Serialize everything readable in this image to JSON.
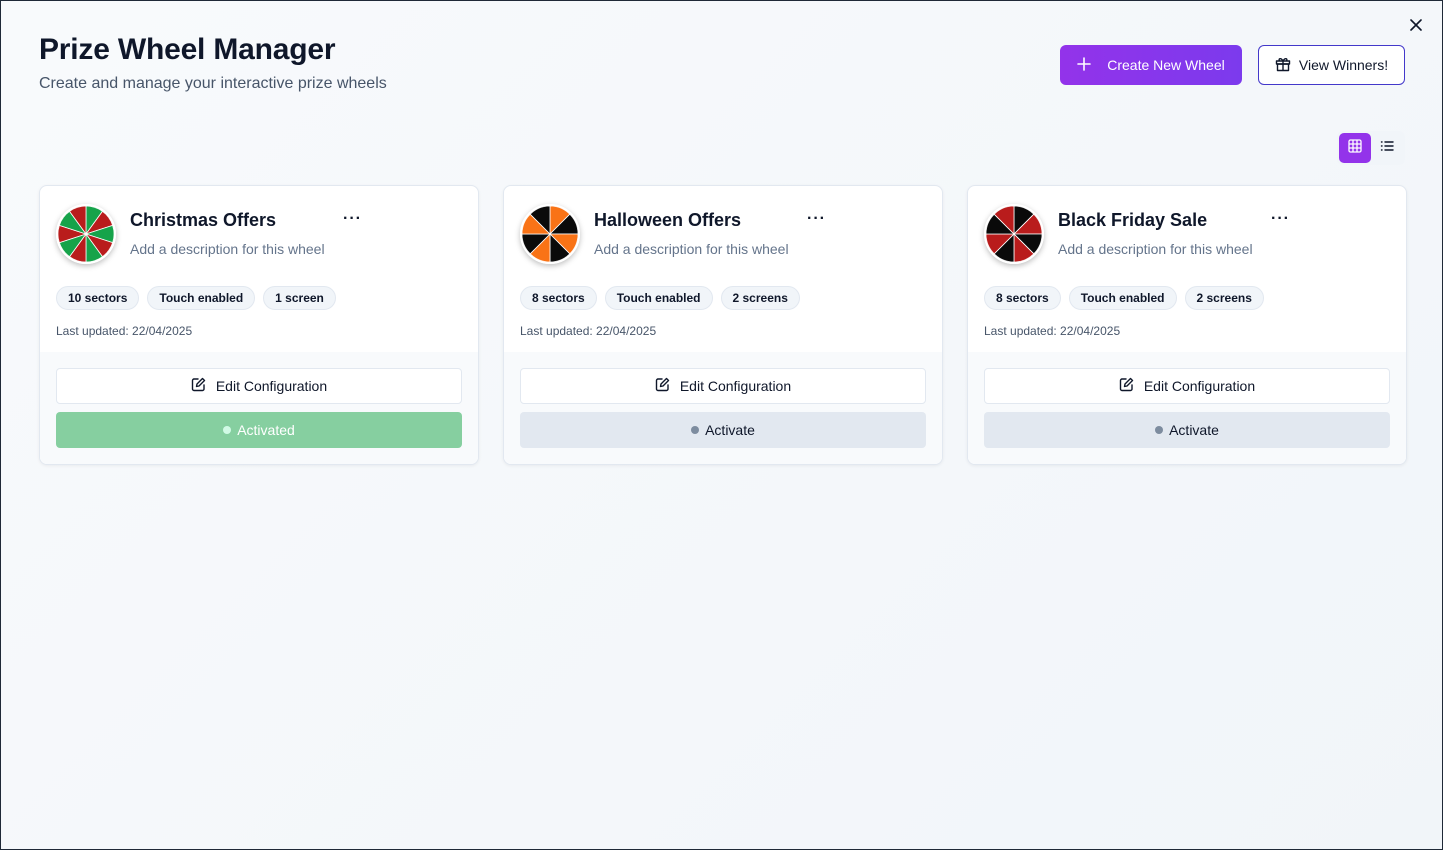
{
  "header": {
    "title": "Prize Wheel Manager",
    "subtitle": "Create and manage your interactive prize wheels",
    "create_label": "Create New Wheel",
    "winners_label": "View Winners!"
  },
  "view_toggle": {
    "active": "grid"
  },
  "wheels": [
    {
      "name": "Christmas Offers",
      "description": "Add a description for this wheel",
      "sectors": "10 sectors",
      "touch": "Touch enabled",
      "screens": "1 screen",
      "updated": "Last updated: 22/04/2025",
      "edit_label": "Edit Configuration",
      "status_label": "Activated",
      "activated": true,
      "colors": [
        "#16a34a",
        "#b91c1c"
      ],
      "sector_count": 10
    },
    {
      "name": "Halloween Offers",
      "description": "Add a description for this wheel",
      "sectors": "8 sectors",
      "touch": "Touch enabled",
      "screens": "2 screens",
      "updated": "Last updated: 22/04/2025",
      "edit_label": "Edit Configuration",
      "status_label": "Activate",
      "activated": false,
      "colors": [
        "#f97316",
        "#0a0a0a"
      ],
      "sector_count": 8
    },
    {
      "name": "Black Friday Sale",
      "description": "Add a description for this wheel",
      "sectors": "8 sectors",
      "touch": "Touch enabled",
      "screens": "2 screens",
      "updated": "Last updated: 22/04/2025",
      "edit_label": "Edit Configuration",
      "status_label": "Activate",
      "activated": false,
      "colors": [
        "#0a0a0a",
        "#b91c1c"
      ],
      "sector_count": 8
    }
  ]
}
